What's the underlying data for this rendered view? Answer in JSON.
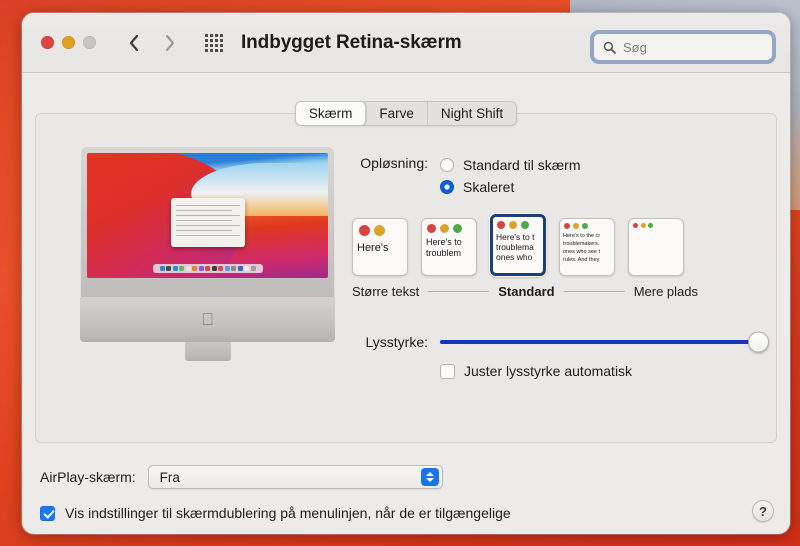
{
  "window": {
    "title": "Indbygget Retina-skærm",
    "traffic_lights": [
      "close",
      "minimize",
      "zoom"
    ],
    "nav": {
      "back": "back-chevron",
      "forward": "forward-chevron"
    },
    "grid_icon": "show-all-icon"
  },
  "search": {
    "placeholder": "Søg",
    "value": "",
    "icon": "search-icon"
  },
  "tabs": [
    {
      "label": "Skærm",
      "active": true
    },
    {
      "label": "Farve",
      "active": false
    },
    {
      "label": "Night Shift",
      "active": false
    }
  ],
  "resolution": {
    "label": "Opløsning:",
    "options": [
      {
        "label": "Standard til skærm",
        "selected": false
      },
      {
        "label": "Skaleret",
        "selected": true
      }
    ],
    "thumbnails": [
      {
        "index": 0,
        "dots": 2,
        "text_lines": [
          "Here's"
        ],
        "style": "big",
        "selected": false
      },
      {
        "index": 1,
        "dots": 3,
        "text_lines": [
          "Here's to",
          "troublem"
        ],
        "style": "medium",
        "selected": false
      },
      {
        "index": 2,
        "dots": 3,
        "text_lines": [
          "Here's to t",
          "troublema",
          "ones who"
        ],
        "style": "standard",
        "selected": true
      },
      {
        "index": 3,
        "dots": 3,
        "text_lines": [
          "Here's to the cr",
          "troublemakers.",
          "ones who see t",
          "rules. And they"
        ],
        "style": "small",
        "selected": false
      },
      {
        "index": 4,
        "dots": 3,
        "text_lines": [],
        "style": "tiny",
        "selected": false
      }
    ],
    "scale_labels": {
      "left": "Større tekst",
      "center": "Standard",
      "right": "Mere plads"
    }
  },
  "brightness": {
    "label": "Lysstyrke:",
    "value": 100,
    "auto_label": "Juster lysstyrke automatisk",
    "auto_checked": false
  },
  "airplay": {
    "label": "AirPlay-skærm:",
    "value": "Fra",
    "options": [
      "Fra"
    ]
  },
  "mirroring": {
    "label": "Vis indstillinger til skærmdublering på menulinjen, når de er tilgængelige",
    "checked": true
  },
  "help": {
    "label": "?"
  },
  "colors": {
    "accent_blue": "#187afa",
    "slider_blue": "#1436b8",
    "selection_border": "#1e3f73",
    "window_bg": "#ecebe9",
    "panel_bg": "#eae8e6"
  }
}
